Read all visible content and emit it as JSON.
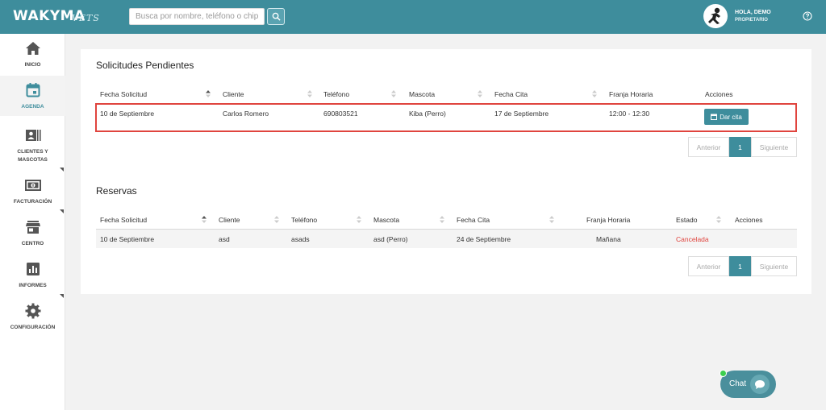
{
  "header": {
    "logo": "WAKYMA",
    "logo_sub": "VETS",
    "search_placeholder": "Busca por nombre, teléfono o chip",
    "user_greeting": "HOLA, DEMO",
    "user_role": "PROPIETARIO",
    "icons": {
      "search": "search-icon",
      "avatar": "user-avatar-icon",
      "help": "help-icon"
    }
  },
  "sidebar": {
    "items": [
      {
        "label": "INICIO",
        "icon": "home-icon"
      },
      {
        "label": "AGENDA",
        "icon": "calendar-icon",
        "active": true
      },
      {
        "label": "CLIENTES Y MASCOTAS",
        "icon": "clients-card-icon"
      },
      {
        "label": "FACTURACIÓN",
        "icon": "banknote-icon"
      },
      {
        "label": "CENTRO",
        "icon": "store-icon"
      },
      {
        "label": "INFORMES",
        "icon": "chart-icon"
      },
      {
        "label": "CONFIGURACIÓN",
        "icon": "gear-icon"
      }
    ]
  },
  "pending": {
    "title": "Solicitudes Pendientes",
    "headers": [
      "Fecha Solicitud",
      "Cliente",
      "Teléfono",
      "Mascota",
      "Fecha Cita",
      "Franja Horaria",
      "Acciones"
    ],
    "rows": [
      {
        "fecha_solicitud": "10 de Septiembre",
        "cliente": "Carlos Romero",
        "telefono": "690803521",
        "mascota": "Kiba (Perro)",
        "fecha_cita": "17 de Septiembre",
        "franja": "12:00 - 12:30",
        "accion": "Dar cita"
      }
    ],
    "pagination": {
      "prev": "Anterior",
      "page": "1",
      "next": "Siguiente"
    }
  },
  "reservas": {
    "title": "Reservas",
    "headers": [
      "Fecha Solicitud",
      "Cliente",
      "Teléfono",
      "Mascota",
      "Fecha Cita",
      "Franja Horaria",
      "Estado",
      "Acciones"
    ],
    "rows": [
      {
        "fecha_solicitud": "10 de Septiembre",
        "cliente": "asd",
        "telefono": "asads",
        "mascota": "asd (Perro)",
        "fecha_cita": "24 de Septiembre",
        "franja": "Mañana",
        "estado": "Cancelada"
      }
    ],
    "pagination": {
      "prev": "Anterior",
      "page": "1",
      "next": "Siguiente"
    }
  },
  "chat": {
    "label": "Chat"
  },
  "colors": {
    "brand": "#3e8d9c",
    "cancelled": "#e0443e",
    "highlight": "#e0443e"
  }
}
